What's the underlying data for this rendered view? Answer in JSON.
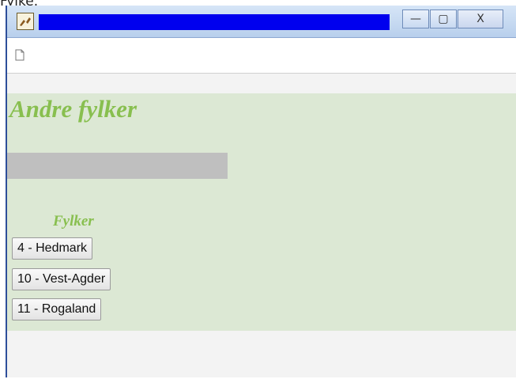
{
  "caption": "Fylke.",
  "window": {
    "buttons": {
      "minimize_glyph": "—",
      "maximize_glyph": "▢",
      "close_glyph": "X"
    }
  },
  "heading": "Andre fylker",
  "list": {
    "label": "Fylker",
    "counties": [
      "4 - Hedmark",
      "10 - Vest-Agder",
      "11 - Rogaland"
    ]
  },
  "colors": {
    "accent_green": "#88bf4f",
    "panel_green": "#dce8d4",
    "title_blue": "#0000ee"
  }
}
